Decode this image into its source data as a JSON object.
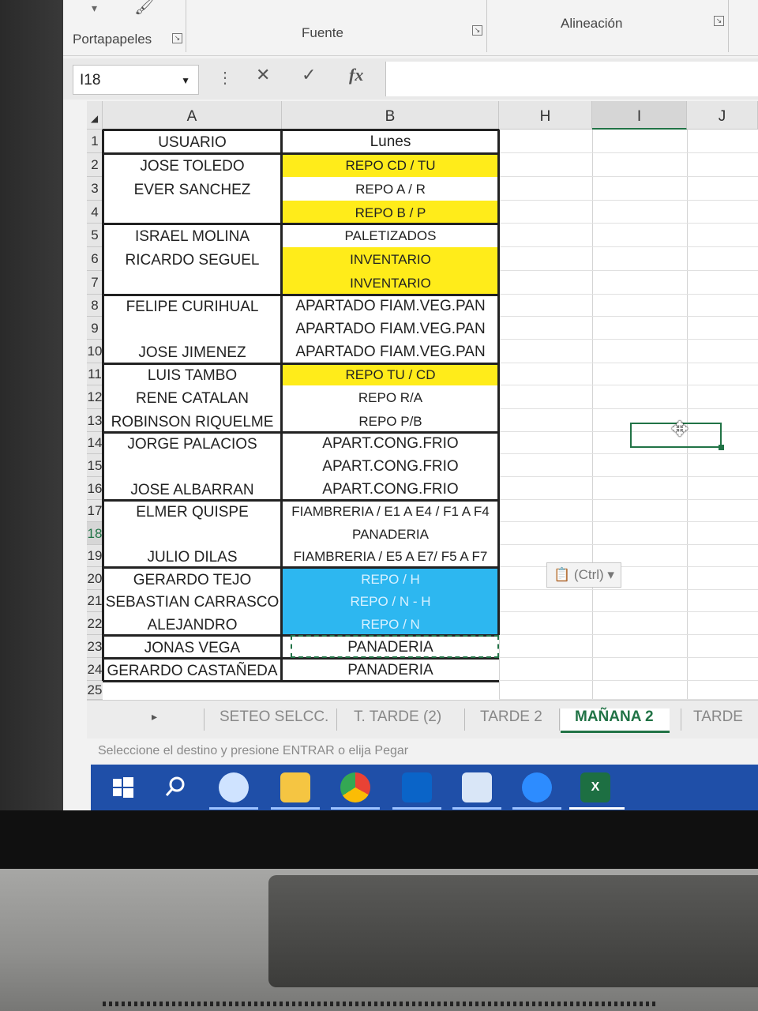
{
  "ribbon": {
    "groups": [
      "Portapapeles",
      "Fuente",
      "Alineación"
    ]
  },
  "formula_bar": {
    "name_box": "I18",
    "fx_label": "fx",
    "cancel_symbol": "✕",
    "enter_symbol": "✓"
  },
  "columns": [
    "A",
    "B",
    "H",
    "I",
    "J"
  ],
  "rows": [
    "1",
    "2",
    "3",
    "4",
    "5",
    "6",
    "7",
    "8",
    "9",
    "10",
    "11",
    "12",
    "13",
    "14",
    "15",
    "16",
    "17",
    "18",
    "19",
    "20",
    "21",
    "22",
    "23",
    "24",
    "25"
  ],
  "cells_a": {
    "r1": "USUARIO",
    "r2": "JOSE TOLEDO",
    "r3": "EVER SANCHEZ",
    "r5": "ISRAEL MOLINA",
    "r6": "RICARDO SEGUEL",
    "r8": "FELIPE CURIHUAL",
    "r10": "JOSE JIMENEZ",
    "r11": "LUIS TAMBO",
    "r12": "RENE CATALAN",
    "r13": "ROBINSON RIQUELME",
    "r14": "JORGE PALACIOS",
    "r16": "JOSE ALBARRAN",
    "r17": "ELMER QUISPE",
    "r19": "JULIO DILAS",
    "r20": "GERARDO TEJO",
    "r21": "SEBASTIAN CARRASCO",
    "r22": "ALEJANDRO",
    "r23": "JONAS VEGA",
    "r24": "GERARDO CASTAÑEDA"
  },
  "cells_b": {
    "r1": "Lunes",
    "r2": "REPO CD /  TU",
    "r3": "REPO A / R",
    "r4": "REPO B / P",
    "r5": "PALETIZADOS",
    "r6": "INVENTARIO",
    "r7": "INVENTARIO",
    "r8": "APARTADO FIAM.VEG.PAN",
    "r9": "APARTADO FIAM.VEG.PAN",
    "r10": "APARTADO FIAM.VEG.PAN",
    "r11": "REPO TU / CD",
    "r12": "REPO R/A",
    "r13": "REPO P/B",
    "r14": "APART.CONG.FRIO",
    "r15": "APART.CONG.FRIO",
    "r16": "APART.CONG.FRIO",
    "r17": "FIAMBRERIA  / E1 A E4 / F1 A F4",
    "r18": "PANADERIA",
    "r19": "FIAMBRERIA  / E5 A E7/ F5 A F7",
    "r20": "REPO / H",
    "r21": "REPO / N - H",
    "r22": "REPO / N",
    "r23": "PANADERIA",
    "r24": "PANADERIA"
  },
  "fill_colors": {
    "yellow": "#ffec1a",
    "blue": "#2db7f0",
    "excel_green": "#217346"
  },
  "paste_options": "(Ctrl) ▾",
  "sheet_tabs": [
    "SETEO SELCC.",
    "T. TARDE (2)",
    "TARDE 2",
    "MAÑANA 2",
    "TARDE"
  ],
  "active_tab": "MAÑANA 2",
  "status_text": "Seleccione el destino y presione ENTRAR o elija Pegar",
  "taskbar_icons": [
    "windows-start-icon",
    "search-icon",
    "cloud-icon",
    "file-explorer-icon",
    "chrome-icon",
    "outlook-icon",
    "office-icon",
    "zoom-icon",
    "excel-icon"
  ]
}
